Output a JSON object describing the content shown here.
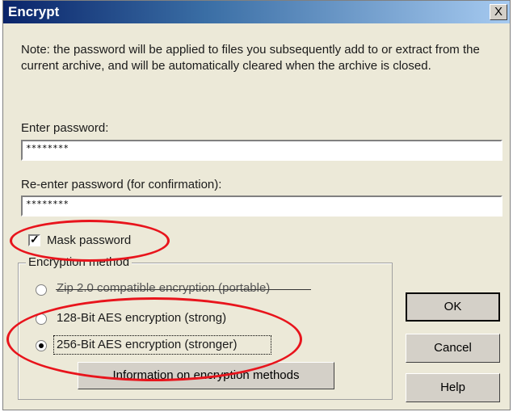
{
  "dialog": {
    "title": "Encrypt",
    "close_glyph": "X",
    "note": "Note: the password will be applied to files you subsequently add to or extract from the current archive, and will be automatically cleared when the archive is closed.",
    "password_label": "Enter password:",
    "password_value": "********",
    "reenter_label": "Re-enter password (for confirmation):",
    "reenter_value": "********",
    "mask_label": "Mask password",
    "mask_checked": true,
    "group_label": "Encryption method",
    "options": [
      {
        "label": "Zip 2.0 compatible encryption (portable)",
        "selected": false
      },
      {
        "label": "128-Bit AES encryption (strong)",
        "selected": false
      },
      {
        "label": "256-Bit AES encryption (stronger)",
        "selected": true
      }
    ],
    "info_button": "Information on encryption methods",
    "ok_button": "OK",
    "cancel_button": "Cancel",
    "help_button": "Help"
  },
  "colors": {
    "annotation": "#e8141c",
    "titlebar": "#0a246a",
    "face": "#ece9d8"
  },
  "icons": {
    "close": "close-icon",
    "check": "checkmark-icon"
  }
}
